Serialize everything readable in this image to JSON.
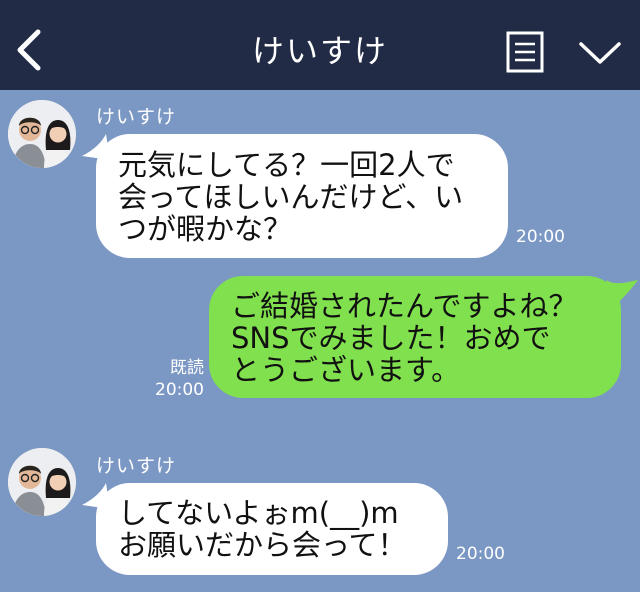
{
  "header": {
    "title": "けいすけ",
    "background": "#212b45"
  },
  "chat": {
    "background": "#7b97c4",
    "messages": [
      {
        "sender": "けいすけ",
        "lines": [
          "元気にしてる？一回2人で",
          "会ってほしいんだけど、い",
          "つが暇かな？"
        ],
        "time": "20:00"
      },
      {
        "lines": [
          "ご結婚されたんですよね？",
          "SNSでみました！おめで",
          "とうございます。"
        ],
        "read": "既読",
        "time": "20:00",
        "bubble_color": "#81e04d"
      },
      {
        "sender": "けいすけ",
        "lines": [
          "してないよぉm(__)m",
          "お願いだから会って！"
        ],
        "time": "20:00"
      }
    ]
  },
  "icons": {
    "back": "chevron-left-icon",
    "menu": "menu-icon",
    "collapse": "chevron-down-icon"
  }
}
